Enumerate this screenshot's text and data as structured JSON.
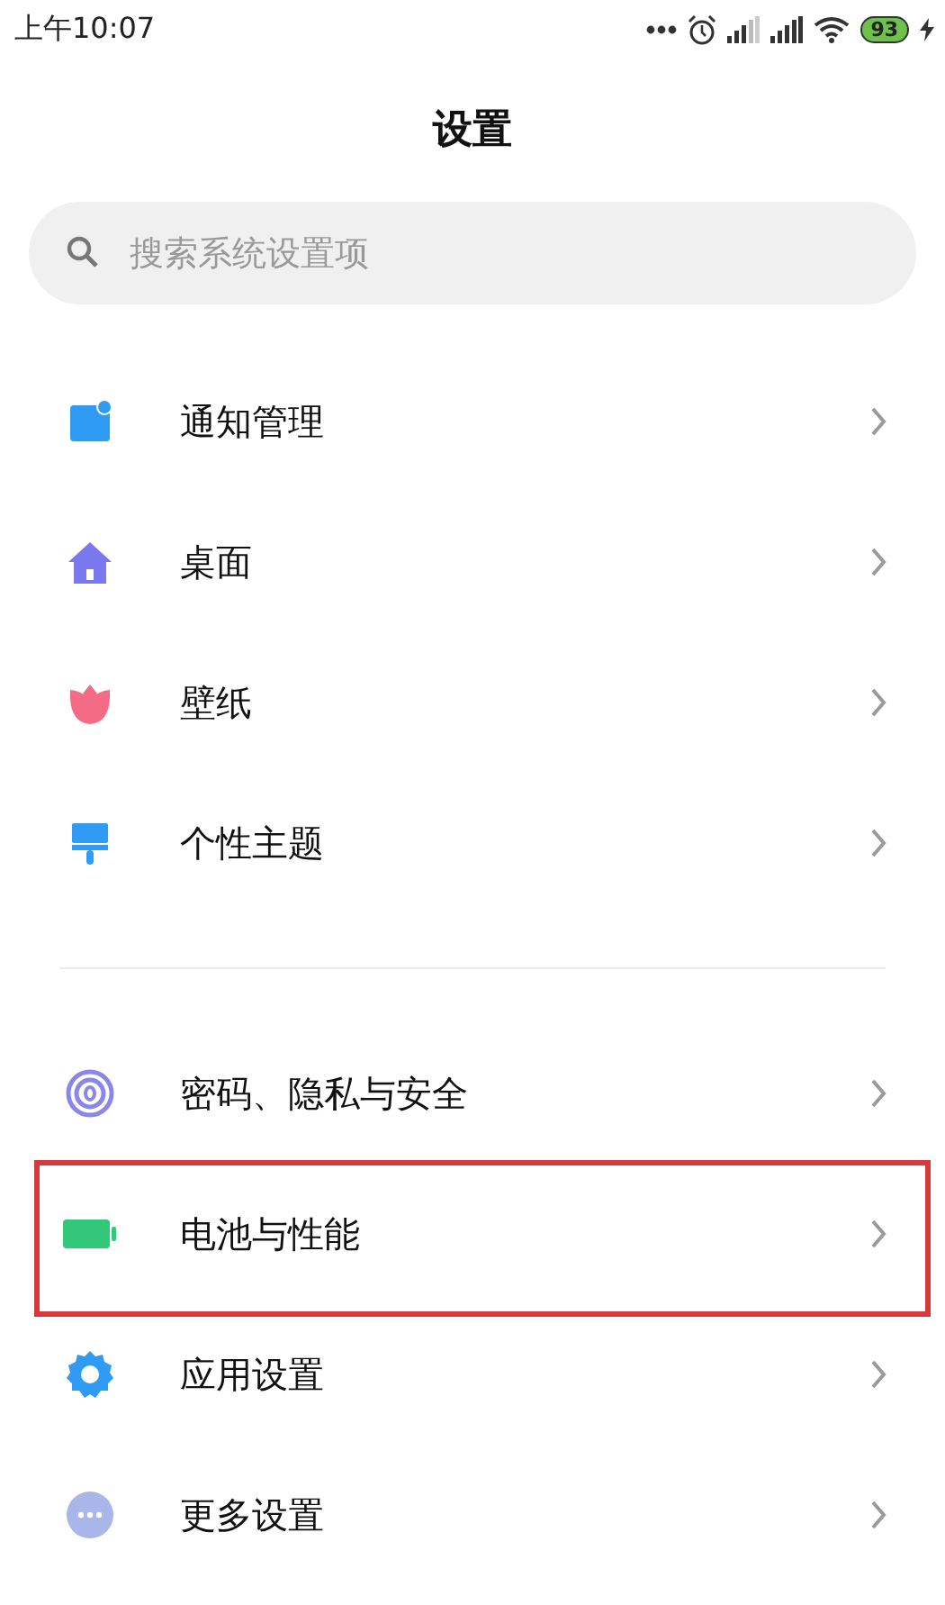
{
  "status_bar": {
    "time": "上午10:07",
    "battery": "93"
  },
  "title": "设置",
  "search": {
    "placeholder": "搜索系统设置项"
  },
  "groups": [
    {
      "items": [
        {
          "label": "通知管理",
          "highlighted": false
        },
        {
          "label": "桌面",
          "highlighted": false
        },
        {
          "label": "壁纸",
          "highlighted": false
        },
        {
          "label": "个性主题",
          "highlighted": false
        }
      ]
    },
    {
      "items": [
        {
          "label": "密码、隐私与安全",
          "highlighted": false
        },
        {
          "label": "电池与性能",
          "highlighted": true
        },
        {
          "label": "应用设置",
          "highlighted": false
        },
        {
          "label": "更多设置",
          "highlighted": false
        }
      ]
    }
  ]
}
